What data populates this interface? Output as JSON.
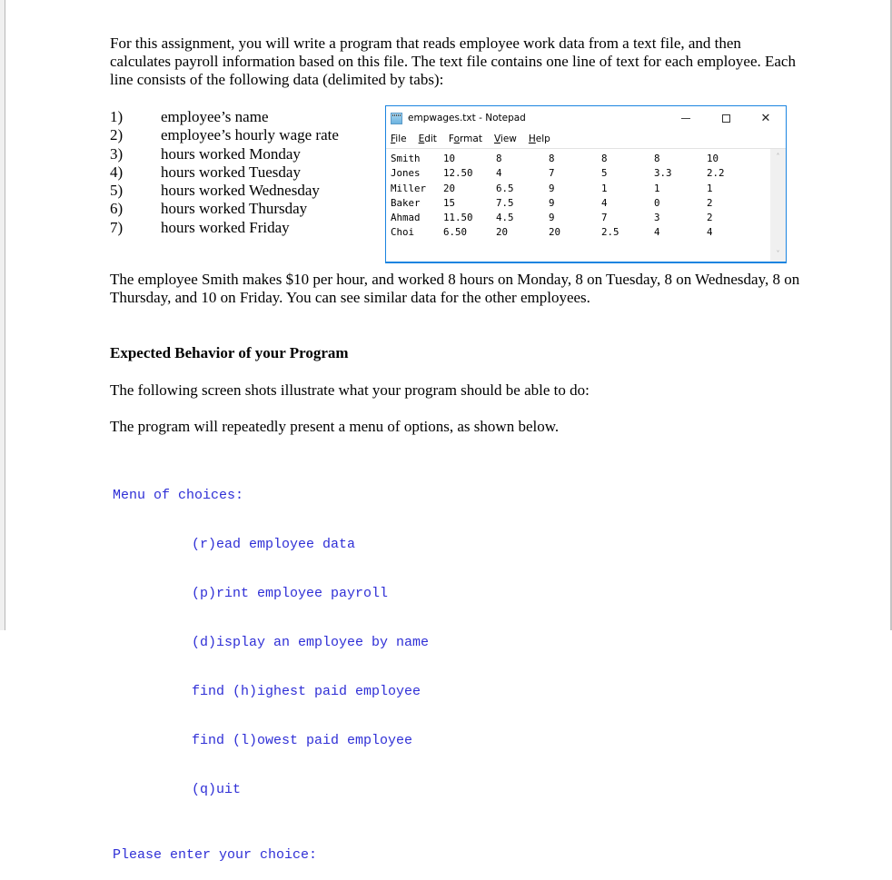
{
  "document": {
    "intro_paragraph": "For this assignment, you will write a program that reads employee work data from a text file, and then calculates payroll information based on this file. The text file contains one line of text for each employee. Each line consists of the following data (delimited by tabs):",
    "field_list": [
      {
        "num": "1)",
        "label": "employee’s name"
      },
      {
        "num": "2)",
        "label": "employee’s hourly wage rate"
      },
      {
        "num": "3)",
        "label": "hours worked Monday"
      },
      {
        "num": "4)",
        "label": "hours worked Tuesday"
      },
      {
        "num": "5)",
        "label": "hours worked Wednesday"
      },
      {
        "num": "6)",
        "label": "hours worked Thursday"
      },
      {
        "num": "7)",
        "label": "hours worked Friday"
      }
    ],
    "example_paragraph": "The employee Smith makes $10 per hour, and worked 8 hours on Monday, 8 on Tuesday, 8 on Wednesday, 8 on Thursday, and 10 on Friday. You can see similar data for the other employees.",
    "section_heading": "Expected Behavior of your Program",
    "screens_paragraph": "The following screen shots illustrate what your program should be able to do:",
    "menu_paragraph": "The program will repeatedly present a menu of options, as shown below."
  },
  "notepad": {
    "title": "empwages.txt - Notepad",
    "icon": "notepad-icon",
    "controls": {
      "minimize": "minimize-icon",
      "maximize": "maximize-icon",
      "close": "✕"
    },
    "menu": [
      {
        "accel": "F",
        "rest": "ile"
      },
      {
        "accel": "E",
        "rest": "dit"
      },
      {
        "pre": "F",
        "accel": "o",
        "rest": "rmat"
      },
      {
        "accel": "V",
        "rest": "iew"
      },
      {
        "accel": "H",
        "rest": "elp"
      }
    ],
    "rows": [
      [
        "Smith",
        "10",
        "8",
        "8",
        "8",
        "8",
        "10"
      ],
      [
        "Jones",
        "12.50",
        "4",
        "7",
        "5",
        "3.3",
        "2.2"
      ],
      [
        "Miller",
        "20",
        "6.5",
        "9",
        "1",
        "1",
        "1"
      ],
      [
        "Baker",
        "15",
        "7.5",
        "9",
        "4",
        "0",
        "2"
      ],
      [
        "Ahmad",
        "11.50",
        "4.5",
        "9",
        "7",
        "3",
        "2"
      ],
      [
        "Choi",
        "6.50",
        "20",
        "20",
        "2.5",
        "4",
        "4"
      ]
    ],
    "scroll_up": "˄",
    "scroll_down": "˅"
  },
  "console": {
    "header": "Menu of choices:",
    "options": [
      "(r)ead employee data",
      "(p)rint employee payroll",
      "(d)isplay an employee by name",
      "find (h)ighest paid employee",
      "find (l)owest paid employee",
      "(q)uit"
    ],
    "prompt": "Please enter your choice:",
    "text_color": "#2f2fd6"
  }
}
